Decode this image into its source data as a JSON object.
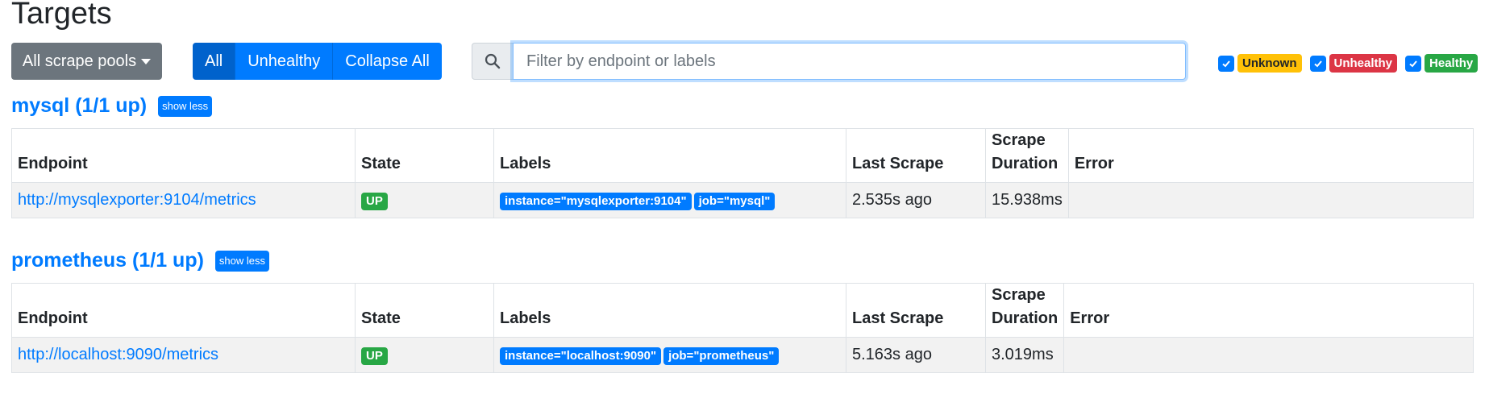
{
  "page": {
    "title": "Targets"
  },
  "toolbar": {
    "pools_label": "All scrape pools",
    "filter_all": "All",
    "filter_unhealthy": "Unhealthy",
    "collapse_all": "Collapse All",
    "search_placeholder": "Filter by endpoint or labels",
    "search_value": ""
  },
  "health_filters": [
    {
      "label": "Unknown",
      "checked": true,
      "color": "#ffc107"
    },
    {
      "label": "Unhealthy",
      "checked": true,
      "color": "#dc3545"
    },
    {
      "label": "Healthy",
      "checked": true,
      "color": "#28a745"
    }
  ],
  "table_headers": {
    "endpoint": "Endpoint",
    "state": "State",
    "labels": "Labels",
    "last_scrape": "Last Scrape",
    "scrape_duration_1": "Scrape",
    "scrape_duration_2": "Duration",
    "error": "Error"
  },
  "pools": [
    {
      "title": "mysql (1/1 up)",
      "toggle_label": "show less",
      "rows": [
        {
          "endpoint": "http://mysqlexporter:9104/metrics",
          "state": "UP",
          "labels": [
            "instance=\"mysqlexporter:9104\"",
            "job=\"mysql\""
          ],
          "last_scrape": "2.535s ago",
          "scrape_duration": "15.938ms",
          "error": ""
        }
      ]
    },
    {
      "title": "prometheus (1/1 up)",
      "toggle_label": "show less",
      "rows": [
        {
          "endpoint": "http://localhost:9090/metrics",
          "state": "UP",
          "labels": [
            "instance=\"localhost:9090\"",
            "job=\"prometheus\""
          ],
          "last_scrape": "5.163s ago",
          "scrape_duration": "3.019ms",
          "error": ""
        }
      ]
    }
  ],
  "colors": {
    "primary": "#007bff",
    "success": "#28a745",
    "warning": "#ffc107",
    "danger": "#dc3545",
    "secondary": "#6c757d"
  }
}
